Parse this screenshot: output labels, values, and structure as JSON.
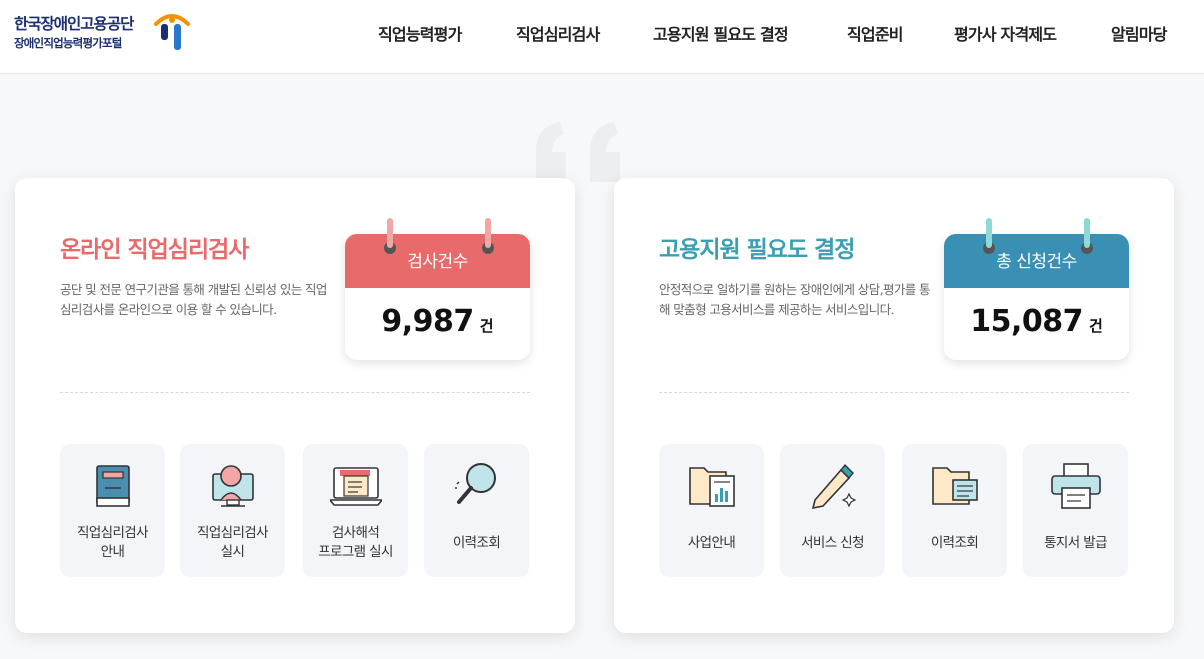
{
  "header": {
    "logo_line1": "한국장애인고용공단",
    "logo_line2": "장애인직업능력평가포털",
    "nav": [
      "직업능력평가",
      "직업심리검사",
      "고용지원 필요도 결정",
      "직업준비",
      "평가사 자격제도",
      "알림마당"
    ]
  },
  "colors": {
    "red": "#e86a6a",
    "teal": "#3a9fb0",
    "navy": "#1b2f72",
    "tile_bg": "#f3f5f9"
  },
  "left_card": {
    "title": "온라인 직업심리검사",
    "description": "공단 및 전문 연구기관을 통해 개발된 신뢰성 있는 직업심리검사를 온라인으로 이용 할 수 있습니다.",
    "calendar": {
      "label": "검사건수",
      "count": "9,987",
      "unit": "건"
    },
    "tiles": [
      {
        "label": "직업심리검사\n안내",
        "icon": "book-icon"
      },
      {
        "label": "직업심리검사\n실시",
        "icon": "monitor-person-icon"
      },
      {
        "label": "검사해석\n프로그램 실시",
        "icon": "laptop-report-icon"
      },
      {
        "label": "이력조회",
        "icon": "magnifier-icon"
      }
    ]
  },
  "right_card": {
    "title": "고용지원 필요도 결정",
    "description": "안정적으로 일하기를 원하는 장애인에게 상담,평가를 통해 맞춤형 고용서비스를 제공하는 서비스입니다.",
    "calendar": {
      "label": "총 신청건수",
      "count": "15,087",
      "unit": "건"
    },
    "tiles": [
      {
        "label": "사업안내",
        "icon": "folder-chart-icon"
      },
      {
        "label": "서비스 신청",
        "icon": "pencil-icon"
      },
      {
        "label": "이력조회",
        "icon": "folder-list-icon"
      },
      {
        "label": "통지서 발급",
        "icon": "printer-icon"
      }
    ]
  }
}
